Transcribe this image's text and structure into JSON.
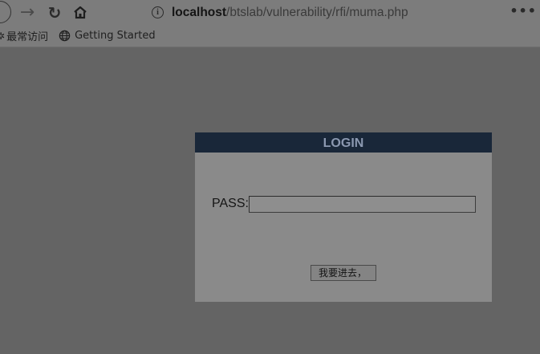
{
  "browser": {
    "url_host": "localhost",
    "url_path": "/btslab/vulnerability/rfi/muma.php",
    "menu_label": "•••",
    "icons": {
      "back": "back-arrow-icon",
      "forward": "forward-arrow-icon",
      "reload": "reload-icon",
      "home": "home-icon",
      "info": "info-icon",
      "menu": "more-menu-icon"
    }
  },
  "bookmarks": {
    "items": [
      {
        "label": "最常访问",
        "icon": "gear-icon"
      },
      {
        "label": "Getting Started",
        "icon": "globe-icon"
      }
    ]
  },
  "login": {
    "title": "LOGIN",
    "pass_label": "PASS:",
    "pass_value": "",
    "submit_label": "我要进去，"
  },
  "colors": {
    "overlay_background": "#646464",
    "header_background": "#192739",
    "header_text": "#8b98b0",
    "dialog_background": "#8a8a8a"
  }
}
